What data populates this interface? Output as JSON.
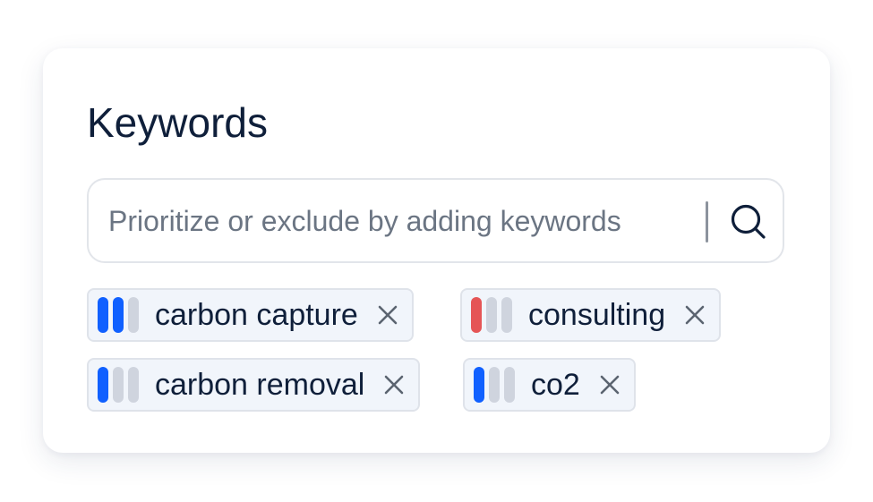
{
  "panel": {
    "title": "Keywords"
  },
  "search": {
    "placeholder": "Prioritize or exclude by adding keywords",
    "value": "",
    "button_icon": "search-icon"
  },
  "keywords": [
    {
      "label": "carbon capture",
      "priority": 2,
      "max_priority": 3,
      "excluded": false,
      "remove_icon": "close-icon"
    },
    {
      "label": "consulting",
      "priority": 1,
      "max_priority": 3,
      "excluded": true,
      "remove_icon": "close-icon"
    },
    {
      "label": "carbon removal",
      "priority": 1,
      "max_priority": 3,
      "excluded": false,
      "remove_icon": "close-icon"
    },
    {
      "label": "co2",
      "priority": 1,
      "max_priority": 3,
      "excluded": false,
      "remove_icon": "close-icon"
    }
  ],
  "colors": {
    "priority_active": "#1060ff",
    "excluded": "#e55556",
    "inactive_bar": "#cfd4de",
    "chip_background": "#f1f5fb",
    "text": "#0f1f3a"
  }
}
